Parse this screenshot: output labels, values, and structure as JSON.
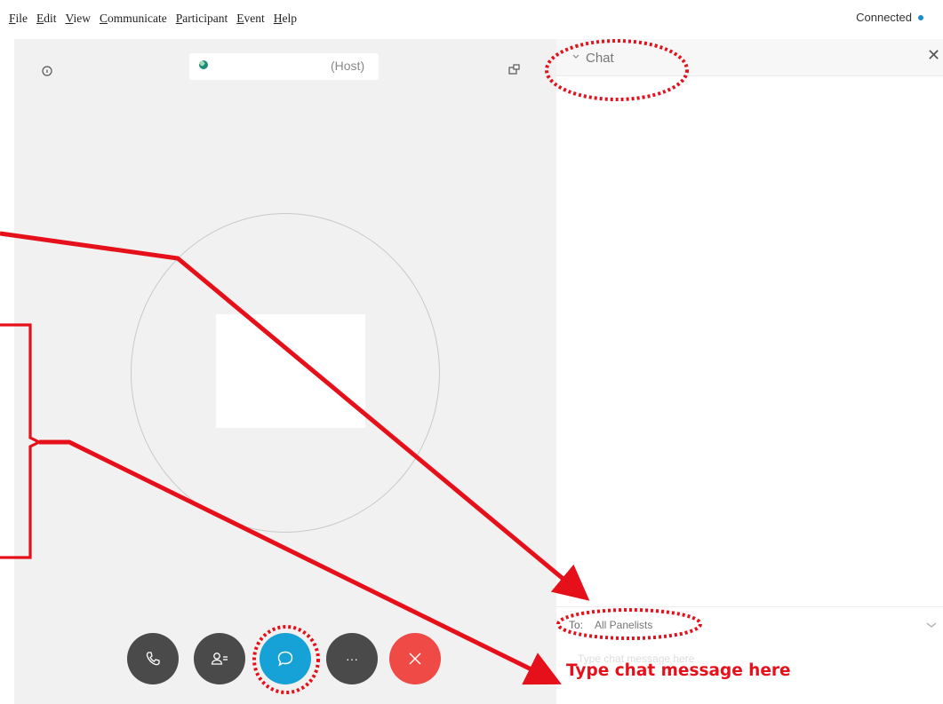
{
  "menubar": {
    "items": [
      "File",
      "Edit",
      "View",
      "Communicate",
      "Participant",
      "Event",
      "Help"
    ],
    "status": "Connected"
  },
  "stage": {
    "host_label": "(Host)",
    "icons": {
      "info": "info-icon",
      "popout": "popout-icon"
    }
  },
  "controls": [
    {
      "name": "phone",
      "icon": "phone-icon"
    },
    {
      "name": "participants",
      "icon": "participants-icon"
    },
    {
      "name": "chat",
      "icon": "chat-bubble-icon"
    },
    {
      "name": "more",
      "icon": "ellipsis-icon",
      "label": "···"
    },
    {
      "name": "leave",
      "icon": "close-icon"
    }
  ],
  "chat": {
    "title": "Chat",
    "to_label": "To:",
    "to_value": "All Panelists",
    "message_placeholder": "Type chat message here"
  },
  "annotations": {
    "callout": "Type chat message here",
    "color": "#e6101b"
  },
  "colors": {
    "accent_blue": "#16a2d6",
    "leave_red": "#f04a47",
    "status_dot": "#1a8ad1"
  }
}
